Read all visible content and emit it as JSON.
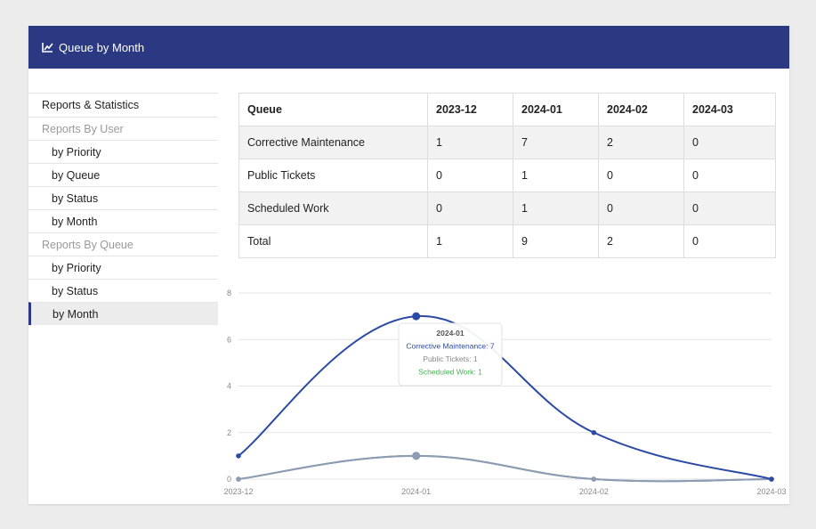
{
  "header": {
    "title": "Queue by Month",
    "icon": "line-chart-icon"
  },
  "sidebar": {
    "items": [
      {
        "label": "Reports & Statistics",
        "kind": "top"
      },
      {
        "label": "Reports By User",
        "kind": "group"
      },
      {
        "label": "by Priority",
        "kind": "sub"
      },
      {
        "label": "by Queue",
        "kind": "sub"
      },
      {
        "label": "by Status",
        "kind": "sub"
      },
      {
        "label": "by Month",
        "kind": "sub"
      },
      {
        "label": "Reports By Queue",
        "kind": "group"
      },
      {
        "label": "by Priority",
        "kind": "sub"
      },
      {
        "label": "by Status",
        "kind": "sub"
      },
      {
        "label": "by Month",
        "kind": "sub",
        "active": true
      }
    ]
  },
  "table": {
    "headers": [
      "Queue",
      "2023-12",
      "2024-01",
      "2024-02",
      "2024-03"
    ],
    "rows": [
      [
        "Corrective Maintenance",
        "1",
        "7",
        "2",
        "0"
      ],
      [
        "Public Tickets",
        "0",
        "1",
        "0",
        "0"
      ],
      [
        "Scheduled Work",
        "0",
        "1",
        "0",
        "0"
      ],
      [
        "Total",
        "1",
        "9",
        "2",
        "0"
      ]
    ]
  },
  "tooltip": {
    "title": "2024-01",
    "lines": [
      "Corrective Maintenance: 7",
      "Public Tickets: 1",
      "Scheduled Work: 1"
    ]
  },
  "colors": {
    "header": "#2b3982",
    "series_corrective": "#2b4aa5",
    "series_public": "#8e9bb3",
    "series_scheduled": "#6a9e8f",
    "tooltip_green": "#3cb94a"
  },
  "chart_data": {
    "type": "line",
    "x": [
      "2023-12",
      "2024-01",
      "2024-02",
      "2024-03"
    ],
    "series": [
      {
        "name": "Corrective Maintenance",
        "values": [
          1,
          7,
          2,
          0
        ]
      },
      {
        "name": "Public Tickets",
        "values": [
          0,
          1,
          0,
          0
        ]
      },
      {
        "name": "Scheduled Work",
        "values": [
          0,
          1,
          0,
          0
        ]
      }
    ],
    "ylim": [
      0,
      8
    ],
    "yticks": [
      0,
      2,
      4,
      6,
      8
    ],
    "grid": true,
    "smooth": true
  }
}
